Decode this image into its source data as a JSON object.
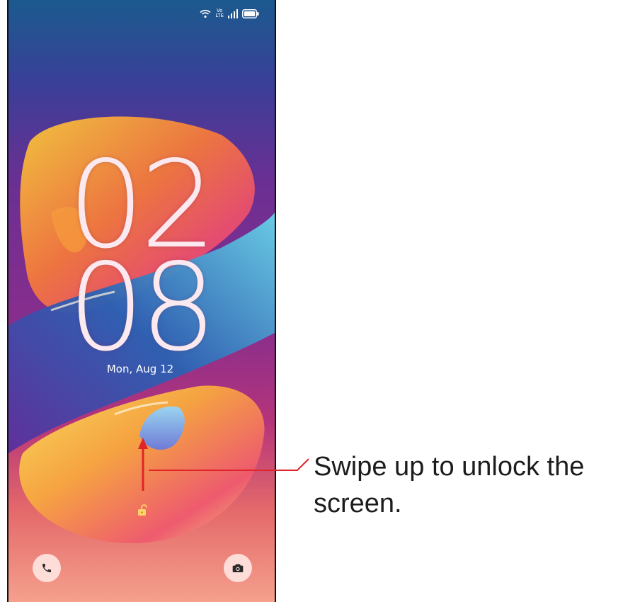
{
  "lock_screen": {
    "clock": {
      "hours": "02",
      "minutes": "08"
    },
    "date": "Mon, Aug 12",
    "status_bar": {
      "icons": [
        "wifi-icon",
        "volte-lte-icon",
        "cellular-signal-icon",
        "battery-icon"
      ],
      "network_top": "Vo",
      "network_bottom": "LTE"
    },
    "shortcuts": {
      "left_icon": "phone-icon",
      "right_icon": "camera-icon",
      "center_icon": "unlock-icon"
    }
  },
  "annotation": {
    "text": "Swipe up to unlock the screen.",
    "color": "#e0242a"
  }
}
